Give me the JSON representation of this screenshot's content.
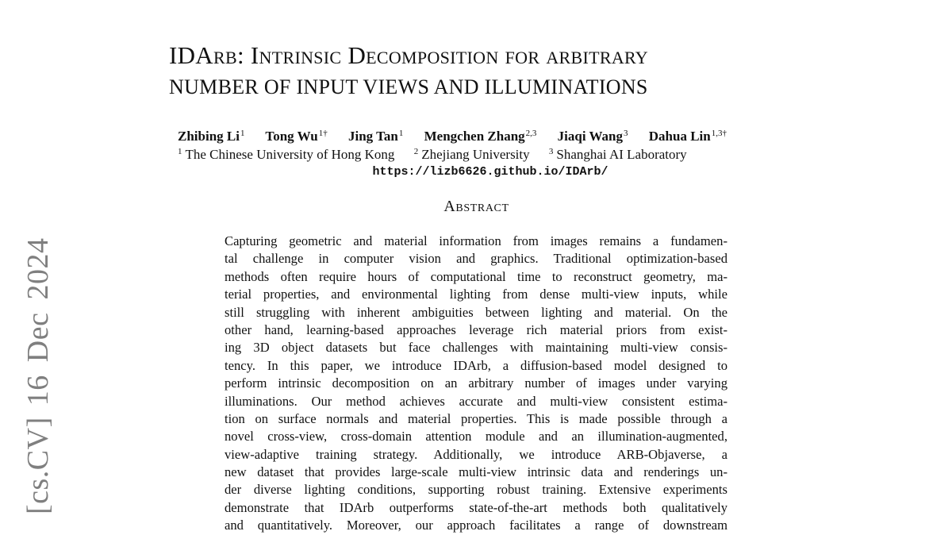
{
  "arxiv_stamp": {
    "category": "[cs.CV]",
    "date": "16 Dec 2024"
  },
  "paper": {
    "title_line1": "IDArb: Intrinsic Decomposition for arbitrary",
    "title_line2": "number of input views and illuminations",
    "title_parts": {
      "p1": "IDA",
      "p2": "rb",
      "p3": ": I",
      "p4": "ntrinsic",
      "p5": " D",
      "p6": "ecomposition",
      "p7": " for arbitrary",
      "line2": "NUMBER OF INPUT VIEWS AND ILLUMINATIONS"
    },
    "authors": [
      {
        "name": "Zhibing Li",
        "sup": "1"
      },
      {
        "name": "Tong Wu",
        "sup": "1†"
      },
      {
        "name": "Jing Tan",
        "sup": "1"
      },
      {
        "name": "Mengchen Zhang",
        "sup": "2,3"
      },
      {
        "name": "Jiaqi Wang",
        "sup": "3"
      },
      {
        "name": "Dahua Lin",
        "sup": "1,3†"
      }
    ],
    "affiliations": [
      {
        "sup": "1",
        "name": "The Chinese University of Hong Kong"
      },
      {
        "sup": "2",
        "name": "Zhejiang University"
      },
      {
        "sup": "3",
        "name": "Shanghai AI Laboratory"
      }
    ],
    "project_url": "https://lizb6626.github.io/IDArb/",
    "abstract_heading": "Abstract",
    "abstract_lines": [
      "Capturing geometric and material information from images remains a fundamen-",
      "tal challenge in computer vision and graphics.  Traditional optimization-based",
      "methods often require hours of computational time to reconstruct geometry, ma-",
      "terial properties, and environmental lighting from dense multi-view inputs, while",
      "still struggling with inherent ambiguities between lighting and material.  On the",
      "other hand, learning-based approaches leverage rich material priors from exist-",
      "ing 3D object datasets but face challenges with maintaining multi-view consis-",
      "tency.  In this paper, we introduce IDArb, a diffusion-based model designed to",
      "perform intrinsic decomposition on an arbitrary number of images under varying",
      "illuminations.  Our method achieves accurate and multi-view consistent estima-",
      "tion on surface normals and material properties. This is made possible through a",
      "novel cross-view, cross-domain attention module and an illumination-augmented,",
      "view-adaptive training strategy.  Additionally, we introduce ARB-Objaverse, a",
      "new dataset that provides large-scale multi-view intrinsic data and renderings un-",
      "der diverse lighting conditions, supporting robust training. Extensive experiments",
      "demonstrate that IDArb outperforms state-of-the-art methods both qualitatively",
      "and quantitatively.  Moreover, our approach facilitates a range of downstream"
    ]
  }
}
